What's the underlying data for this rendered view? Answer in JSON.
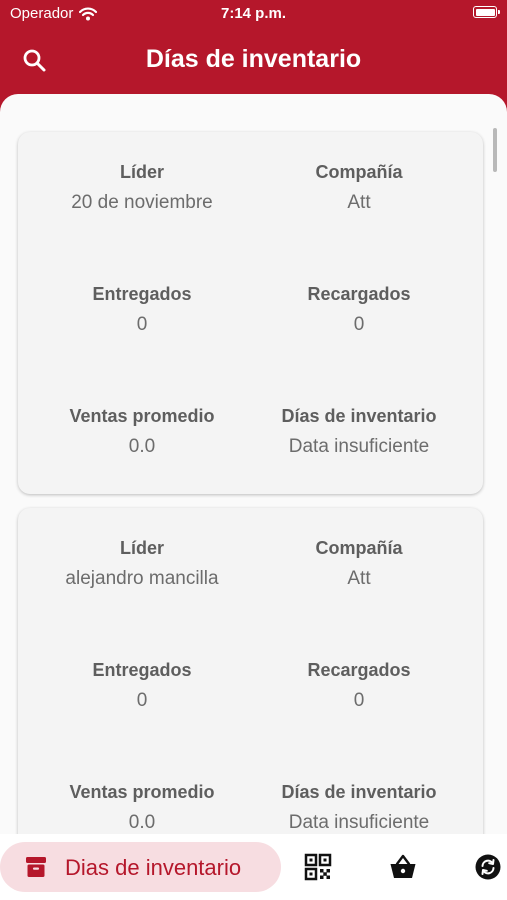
{
  "status_bar": {
    "carrier": "Operador",
    "time": "7:14 p.m."
  },
  "header": {
    "title": "Días de inventario"
  },
  "labels": {
    "leader": "Líder",
    "company": "Compañía",
    "delivered": "Entregados",
    "recharged": "Recargados",
    "avg_sales": "Ventas promedio",
    "inventory_days": "Días de inventario"
  },
  "cards": [
    {
      "leader": "20 de noviembre",
      "company": "Att",
      "delivered": "0",
      "recharged": "0",
      "avg_sales": "0.0",
      "inventory_days": "Data insuficiente"
    },
    {
      "leader": "alejandro mancilla",
      "company": "Att",
      "delivered": "0",
      "recharged": "0",
      "avg_sales": "0.0",
      "inventory_days": "Data insuficiente"
    }
  ],
  "bottom_nav": {
    "active_label": "Dias de inventario",
    "items": [
      {
        "icon": "archive-box-icon",
        "active": true
      },
      {
        "icon": "qr-code-icon",
        "active": false
      },
      {
        "icon": "shopping-basket-icon",
        "active": false
      },
      {
        "icon": "sync-icon",
        "active": false
      }
    ]
  },
  "colors": {
    "brand": "#b5172b",
    "active_pill": "#f7dde1",
    "background": "#fafafa",
    "card": "#f4f4f4"
  }
}
